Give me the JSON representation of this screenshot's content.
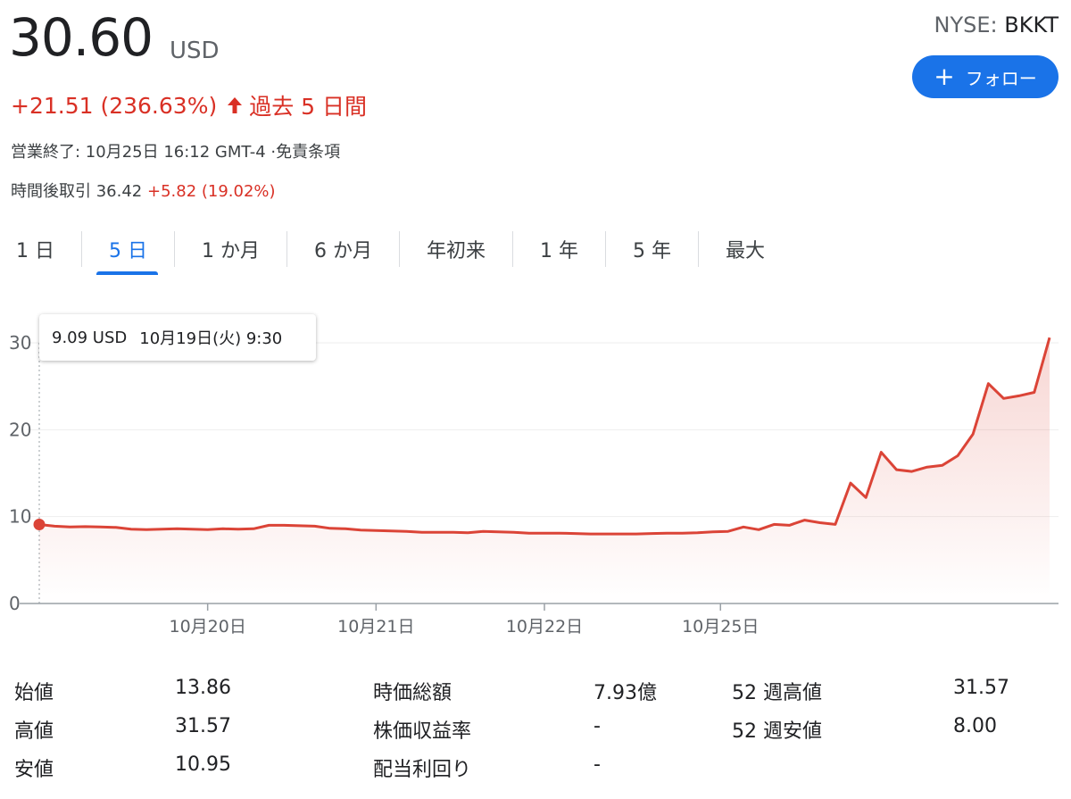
{
  "header": {
    "price": "30.60",
    "currency": "USD",
    "exchange": "NYSE:",
    "symbol": "BKKT",
    "follow_label": "フォロー",
    "change": "+21.51 (236.63%)",
    "change_period": "過去 5 日間",
    "market_status": "営業終了: 10月25日 16:12 GMT-4 ·",
    "disclaimer": "免責条項",
    "after_hours_label": "時間後取引 36.42",
    "after_hours_change": "+5.82 (19.02%)"
  },
  "tabs": [
    "1 日",
    "5 日",
    "1 か月",
    "6 か月",
    "年初来",
    "1 年",
    "5 年",
    "最大"
  ],
  "active_tab": "5 日",
  "tooltip": {
    "value": "9.09 USD",
    "time": "10月19日(火) 9:30"
  },
  "colors": {
    "accent": "#1a73e8",
    "negative_red": "#d93025",
    "line": "#db4437"
  },
  "chart_data": {
    "type": "area",
    "ylim": [
      0,
      30
    ],
    "yticks": [
      0,
      10,
      20,
      30
    ],
    "xtick_labels": [
      "10月20日",
      "10月21日",
      "10月22日",
      "10月25日"
    ],
    "xtick_positions": [
      11,
      22,
      33,
      44.5
    ],
    "x": [
      0,
      1,
      2,
      3,
      4,
      5,
      6,
      7,
      8,
      9,
      10,
      11,
      12,
      13,
      14,
      15,
      16,
      17,
      18,
      19,
      20,
      21,
      22,
      23,
      24,
      25,
      26,
      27,
      28,
      29,
      30,
      31,
      32,
      33,
      34,
      35,
      36,
      37,
      38,
      39,
      40,
      41,
      42,
      43,
      44,
      45,
      46,
      47,
      48,
      49,
      50,
      51,
      52,
      53,
      54,
      55
    ],
    "values": [
      9.09,
      8.9,
      8.8,
      8.85,
      8.8,
      8.75,
      8.55,
      8.5,
      8.55,
      8.6,
      8.55,
      8.5,
      8.6,
      8.55,
      8.6,
      9.0,
      9.0,
      8.95,
      8.9,
      8.65,
      8.6,
      8.45,
      8.4,
      8.35,
      8.3,
      8.2,
      8.2,
      8.2,
      8.15,
      8.3,
      8.25,
      8.2,
      8.1,
      8.1,
      8.1,
      8.05,
      8.0,
      8.0,
      8.0,
      8.0,
      8.05,
      8.1,
      8.1,
      8.15,
      8.25,
      8.3,
      8.8,
      8.5,
      9.1,
      9.0,
      9.6,
      9.3,
      9.1,
      13.86,
      12.2,
      17.4
    ],
    "values_tail": [
      15.4,
      15.2,
      15.7,
      15.9,
      17.0,
      19.5,
      25.3,
      23.6,
      23.9,
      24.3,
      30.6
    ]
  },
  "stats": {
    "col1": [
      {
        "label": "始値",
        "value": "13.86"
      },
      {
        "label": "高値",
        "value": "31.57"
      },
      {
        "label": "安値",
        "value": "10.95"
      }
    ],
    "col2": [
      {
        "label": "時価総額",
        "value": "7.93億"
      },
      {
        "label": "株価収益率",
        "value": "-"
      },
      {
        "label": "配当利回り",
        "value": "-"
      }
    ],
    "col3": [
      {
        "label": "52 週高値",
        "value": "31.57"
      },
      {
        "label": "52 週安値",
        "value": "8.00"
      }
    ]
  }
}
